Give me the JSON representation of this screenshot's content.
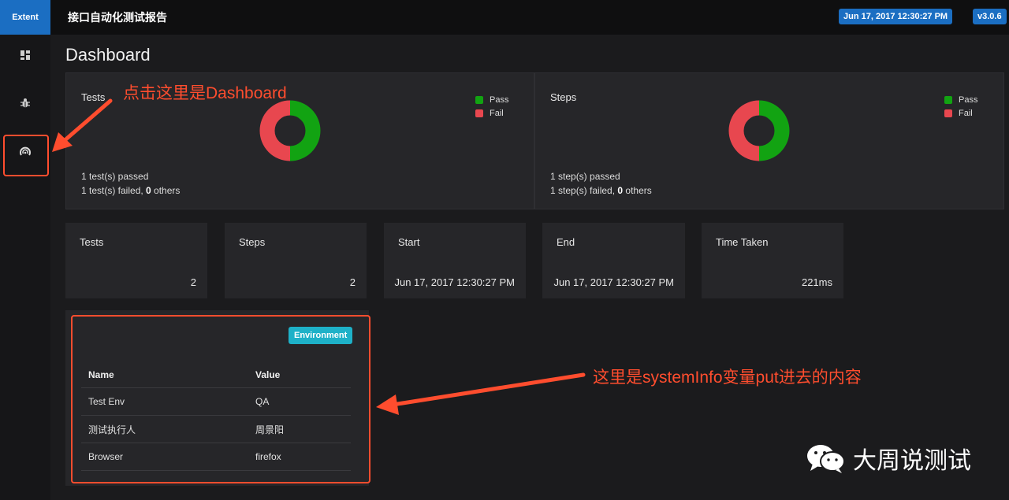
{
  "brand": "Extent",
  "topbar": {
    "report_title": "接口自动化测试报告",
    "date_badge": "Jun 17, 2017 12:30:27 PM",
    "version_badge": "v3.0.6"
  },
  "sidebar": {
    "items": [
      {
        "icon": "dashboard-grid-icon"
      },
      {
        "icon": "bug-icon"
      },
      {
        "icon": "dashboard-gauge-icon"
      }
    ]
  },
  "page_title": "Dashboard",
  "tests_panel": {
    "title": "Tests",
    "legend": [
      {
        "label": "Pass",
        "color": "#12a312"
      },
      {
        "label": "Fail",
        "color": "#e8474f"
      }
    ],
    "donut": {
      "pass": 1,
      "fail": 1
    },
    "passed_line": "1 test(s) passed",
    "failed_prefix": "1 test(s) failed, ",
    "others_count": "0",
    "others_suffix": " others"
  },
  "steps_panel": {
    "title": "Steps",
    "legend": [
      {
        "label": "Pass",
        "color": "#12a312"
      },
      {
        "label": "Fail",
        "color": "#e8474f"
      }
    ],
    "donut": {
      "pass": 1,
      "fail": 1
    },
    "passed_line": "1 step(s) passed",
    "failed_prefix": "1 step(s) failed, ",
    "others_count": "0",
    "others_suffix": " others"
  },
  "stats": [
    {
      "label": "Tests",
      "value": "2"
    },
    {
      "label": "Steps",
      "value": "2"
    },
    {
      "label": "Start",
      "value": "Jun 17, 2017 12:30:27 PM"
    },
    {
      "label": "End",
      "value": "Jun 17, 2017 12:30:27 PM"
    },
    {
      "label": "Time Taken",
      "value": "221ms"
    }
  ],
  "environment": {
    "badge": "Environment",
    "headers": {
      "name": "Name",
      "value": "Value"
    },
    "rows": [
      {
        "name": "Test Env",
        "value": "QA"
      },
      {
        "name": "测试执行人",
        "value": "周景阳"
      },
      {
        "name": "Browser",
        "value": "firefox"
      }
    ]
  },
  "annotations": {
    "dashboard_note": "点击这里是Dashboard",
    "env_note": "这里是systemInfo变量put进去的内容",
    "color": "#ff4d2e"
  },
  "watermark": {
    "text": "大周说测试",
    "icon": "wechat-icon"
  }
}
